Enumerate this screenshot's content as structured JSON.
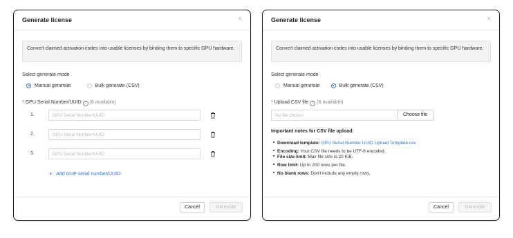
{
  "left": {
    "title": "Generate license",
    "close": "×",
    "info": "Convert claimed activation codes into usable licenses by binding them to specific GPU hardware.",
    "mode_label": "Select generate mode",
    "mode_options": [
      "Manual generate",
      "Bulk generate (CSV)"
    ],
    "selected_mode": "Manual generate",
    "serial_label": "GPU Serial Number/UUID",
    "serial_available": "(6 available)",
    "serial_rows": [
      {
        "num": "1.",
        "placeholder": "GPU Serial Number/UUID"
      },
      {
        "num": "2.",
        "placeholder": "GPU Serial Number/UUID"
      },
      {
        "num": "3.",
        "placeholder": "GPU Serial Number/UUID"
      }
    ],
    "add_label": "Add GUP serial number/UUID",
    "cancel": "Cancel",
    "generate": "Generate"
  },
  "right": {
    "title": "Generate license",
    "close": "×",
    "info": "Convert claimed activation codes into usable licenses by binding them to specific GPU hardware.",
    "mode_label": "Select generate mode",
    "mode_options": [
      "Manual generate",
      "Bulk generate (CSV)"
    ],
    "selected_mode": "Bulk generate (CSV)",
    "upload_label": "Upload CSV file",
    "upload_available": "(6 available)",
    "file_placeholder": "No file chosen",
    "choose_file": "Choose file",
    "notes_title": "Important notes for CSV file upload:",
    "notes": [
      {
        "key": "Download template:",
        "text": "GPU Serial Number UUID Upload Template.csv"
      },
      {
        "key": "Encoding:",
        "text": "Your CSV file needs to be UTF-8 encoded."
      },
      {
        "key": "File size limit:",
        "text": "Max file size is 20 KiB."
      },
      {
        "key": "Row limit:",
        "text": "Up to 200 rows per file."
      },
      {
        "key": "No blank rows:",
        "text": "Don't include any empty rows."
      }
    ],
    "cancel": "Cancel",
    "generate": "Generate"
  },
  "colors": {
    "accent": "#2f6fde",
    "required": "#d9342b",
    "disabled_text": "#bdbdbd"
  }
}
